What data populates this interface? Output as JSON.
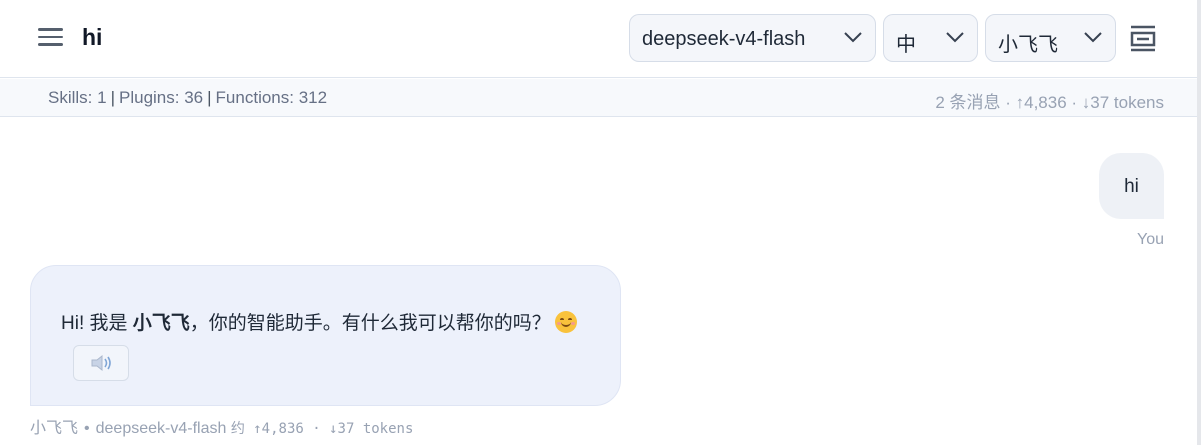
{
  "header": {
    "title": "hi",
    "model_select": {
      "value": "deepseek-v4-flash"
    },
    "language_select": {
      "value": "中"
    },
    "agent_select": {
      "value": "小飞飞"
    }
  },
  "statusbar": {
    "skills": "Skills: 1",
    "plugins": "Plugins: 36",
    "functions": "Functions: 312",
    "summary": "2 条消息 · ↑4,836 · ↓37 tokens"
  },
  "messages": {
    "user": {
      "text": "hi",
      "sender": "You"
    },
    "assistant": {
      "text_before": "Hi! 我是 ",
      "text_bold": "小飞飞",
      "text_after": "，你的智能助手。有什么我可以帮你的吗？",
      "meta_agent": "小飞飞",
      "meta_model": "deepseek-v4-flash",
      "meta_usage": "约 ↑4,836 · ↓37 tokens"
    }
  },
  "icons": {
    "menu": "hamburger-menu-icon",
    "chevron": "chevron-down-icon",
    "layout": "layout-panel-icon",
    "speaker": "speaker-icon",
    "emoji": "smiling-face-emoji-icon"
  },
  "colors": {
    "accent_bubble": "#edf1fb",
    "user_bubble": "#eef1f6",
    "muted_text": "#98a2b3",
    "border": "#dfe5ee"
  }
}
